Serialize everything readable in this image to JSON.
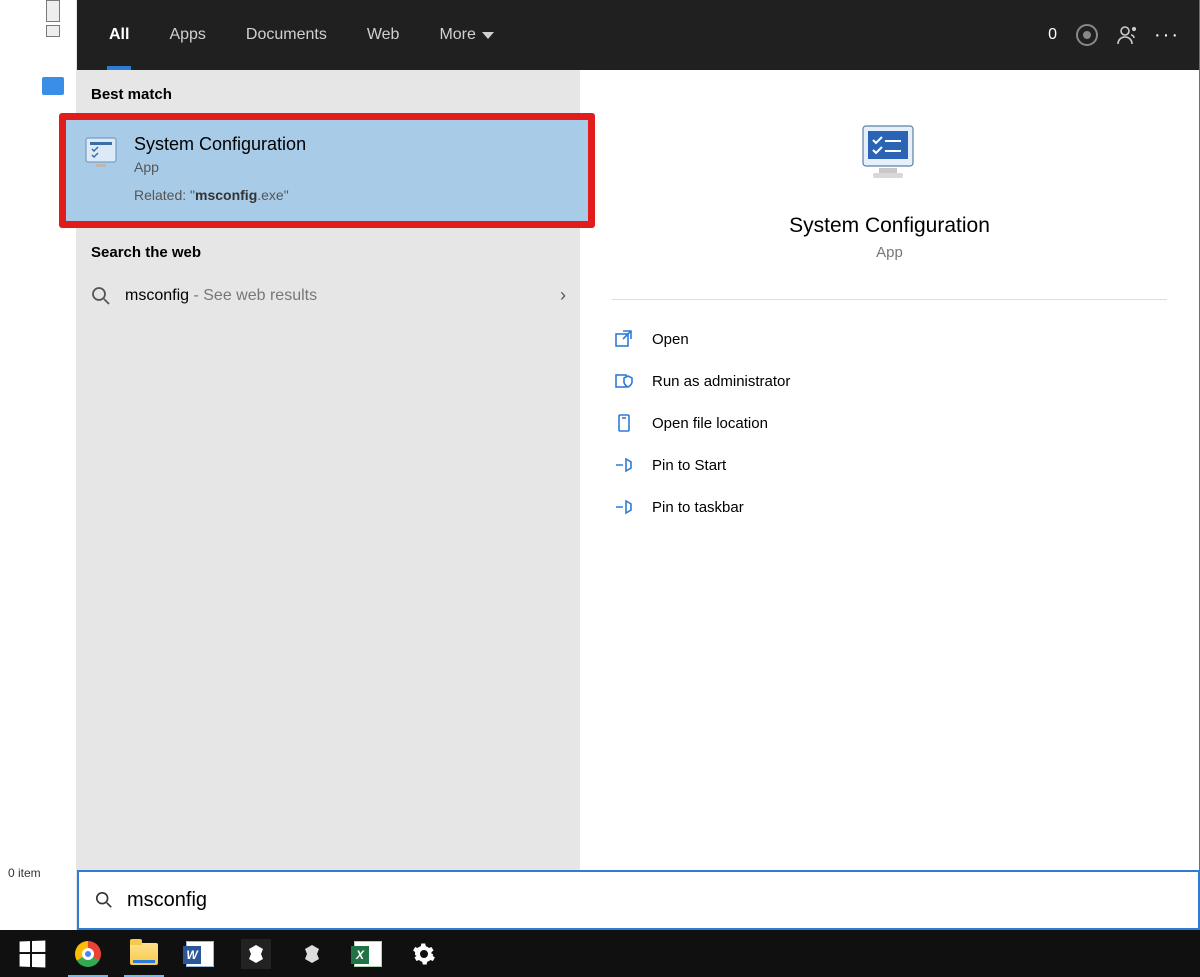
{
  "header": {
    "tabs": [
      "All",
      "Apps",
      "Documents",
      "Web",
      "More"
    ],
    "badge": "0"
  },
  "left": {
    "best_match_header": "Best match",
    "best_match": {
      "title": "System Configuration",
      "subtitle": "App",
      "related_prefix": "Related: \"",
      "related_bold": "msconfig",
      "related_suffix": ".exe\""
    },
    "search_web_header": "Search the web",
    "web_result": {
      "query": "msconfig",
      "suffix": " - See web results"
    }
  },
  "preview": {
    "title": "System Configuration",
    "subtitle": "App",
    "actions": [
      "Open",
      "Run as administrator",
      "Open file location",
      "Pin to Start",
      "Pin to taskbar"
    ]
  },
  "searchbox": {
    "value": "msconfig"
  },
  "statusbar": {
    "left": "0 item"
  }
}
